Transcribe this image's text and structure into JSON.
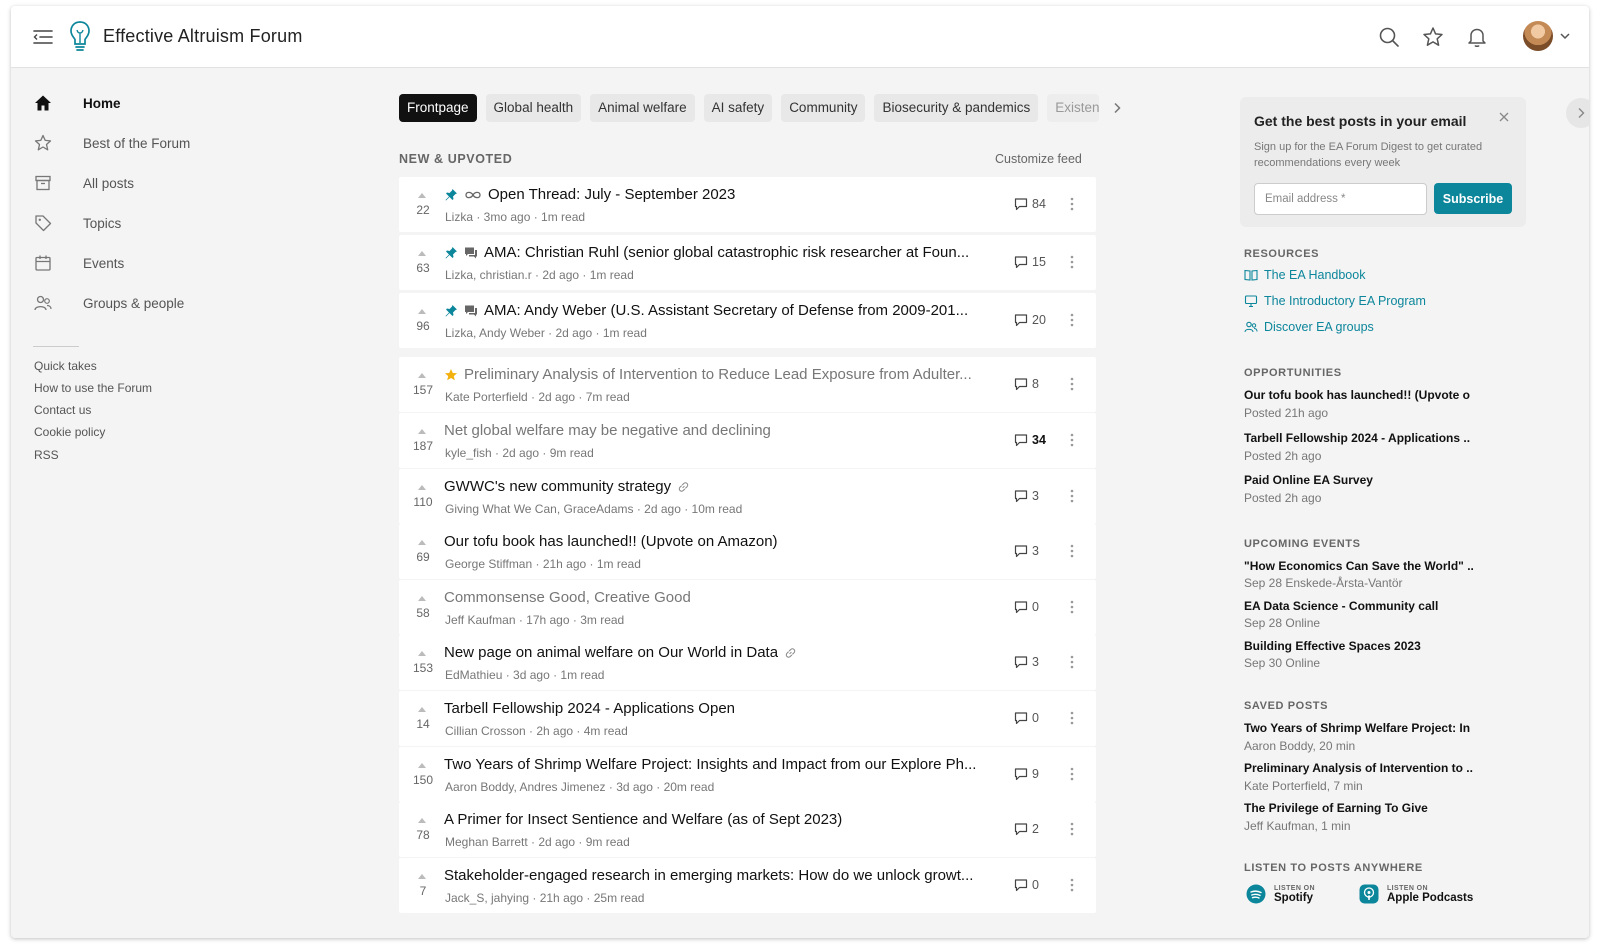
{
  "header": {
    "site_title": "Effective Altruism Forum"
  },
  "nav": {
    "items": [
      {
        "label": "Home",
        "icon": "home-icon"
      },
      {
        "label": "Best of the Forum",
        "icon": "star-icon"
      },
      {
        "label": "All posts",
        "icon": "archive-icon"
      },
      {
        "label": "Topics",
        "icon": "tag-icon"
      },
      {
        "label": "Events",
        "icon": "calendar-icon"
      },
      {
        "label": "Groups & people",
        "icon": "people-icon"
      }
    ],
    "links": [
      "Quick takes",
      "How to use the Forum",
      "Contact us",
      "Cookie policy",
      "RSS"
    ]
  },
  "tabs": [
    "Frontpage",
    "Global health",
    "Animal welfare",
    "AI safety",
    "Community",
    "Biosecurity & pandemics",
    "Existential risk"
  ],
  "feed": {
    "section_title": "NEW & UPVOTED",
    "customize_label": "Customize feed",
    "posts": [
      {
        "karma": "22",
        "title": "Open Thread: July - September 2023",
        "meta": "Lizka · 3mo ago · 1m read",
        "comments": "84"
      },
      {
        "karma": "63",
        "title": "AMA: Christian Ruhl (senior global catastrophic risk researcher at Foun...",
        "meta": "Lizka, christian.r · 2d ago · 1m read",
        "comments": "15"
      },
      {
        "karma": "96",
        "title": "AMA: Andy Weber (U.S. Assistant Secretary of Defense from 2009-201...",
        "meta": "Lizka, Andy Weber · 2d ago · 1m read",
        "comments": "20"
      },
      {
        "karma": "157",
        "title": "Preliminary Analysis of Intervention to Reduce Lead Exposure from Adulter...",
        "meta": "Kate Porterfield · 2d ago · 7m read",
        "comments": "8"
      },
      {
        "karma": "187",
        "title": "Net global welfare may be negative and declining",
        "meta": "kyle_fish · 2d ago · 9m read",
        "comments": "34"
      },
      {
        "karma": "110",
        "title": "GWWC's new community strategy",
        "meta": "Giving What We Can, GraceAdams · 2d ago · 10m read",
        "comments": "3"
      },
      {
        "karma": "69",
        "title": "Our tofu book has launched!! (Upvote on Amazon)",
        "meta": "George Stiffman · 21h ago · 1m read",
        "comments": "3"
      },
      {
        "karma": "58",
        "title": "Commonsense Good, Creative Good",
        "meta": "Jeff Kaufman · 17h ago · 3m read",
        "comments": "0"
      },
      {
        "karma": "153",
        "title": "New page on animal welfare on Our World in Data",
        "meta": "EdMathieu · 3d ago · 1m read",
        "comments": "3"
      },
      {
        "karma": "14",
        "title": "Tarbell Fellowship 2024 - Applications Open",
        "meta": "Cillian Crosson · 2h ago · 4m read",
        "comments": "0"
      },
      {
        "karma": "150",
        "title": "Two Years of Shrimp Welfare Project: Insights and Impact from our Explore Ph...",
        "meta": "Aaron Boddy, Andres Jimenez · 3d ago · 20m read",
        "comments": "9"
      },
      {
        "karma": "78",
        "title": "A Primer for Insect Sentience and Welfare (as of Sept 2023)",
        "meta": "Meghan Barrett · 2d ago · 9m read",
        "comments": "2"
      },
      {
        "karma": "7",
        "title": "Stakeholder-engaged research in emerging markets: How do we unlock growt...",
        "meta": "Jack_S, jahying · 21h ago · 25m read",
        "comments": "0"
      }
    ]
  },
  "digest": {
    "title": "Get the best posts in your email",
    "description": "Sign up for the EA Forum Digest to get curated recommendations every week",
    "email_placeholder": "Email address *",
    "subscribe_label": "Subscribe"
  },
  "resources": {
    "title": "RESOURCES",
    "items": [
      "The EA Handbook",
      "The Introductory EA Program",
      "Discover EA groups"
    ]
  },
  "opportunities": {
    "title": "OPPORTUNITIES",
    "items": [
      {
        "title": "Our tofu book has launched!! (Upvote o",
        "sub": "Posted 21h ago"
      },
      {
        "title": "Tarbell Fellowship 2024 - Applications ..",
        "sub": "Posted 2h ago"
      },
      {
        "title": "Paid Online EA Survey",
        "sub": "Posted 2h ago"
      }
    ]
  },
  "events": {
    "title": "UPCOMING EVENTS",
    "items": [
      {
        "title": "\"How Economics Can Save the World\" ..",
        "sub": "Sep 28  Enskede-Årsta-Vantör"
      },
      {
        "title": "EA Data Science - Community call",
        "sub": "Sep 28  Online"
      },
      {
        "title": "Building Effective Spaces 2023",
        "sub": "Sep 30  Online"
      }
    ]
  },
  "saved": {
    "title": "SAVED POSTS",
    "items": [
      {
        "title": "Two Years of Shrimp Welfare Project: In",
        "sub": "Aaron Boddy, 20 min"
      },
      {
        "title": "Preliminary Analysis of Intervention to ..",
        "sub": "Kate Porterfield, 7 min"
      },
      {
        "title": "The Privilege of Earning To Give",
        "sub": "Jeff Kaufman, 1 min"
      }
    ]
  },
  "listen": {
    "title": "LISTEN TO POSTS ANYWHERE",
    "listen_on": "LISTEN ON",
    "spotify": "Spotify",
    "apple": "Apple Podcasts"
  },
  "colors": {
    "accent": "#0c869b",
    "pin": "#0c869b",
    "curated_star": "#f2b10d"
  }
}
